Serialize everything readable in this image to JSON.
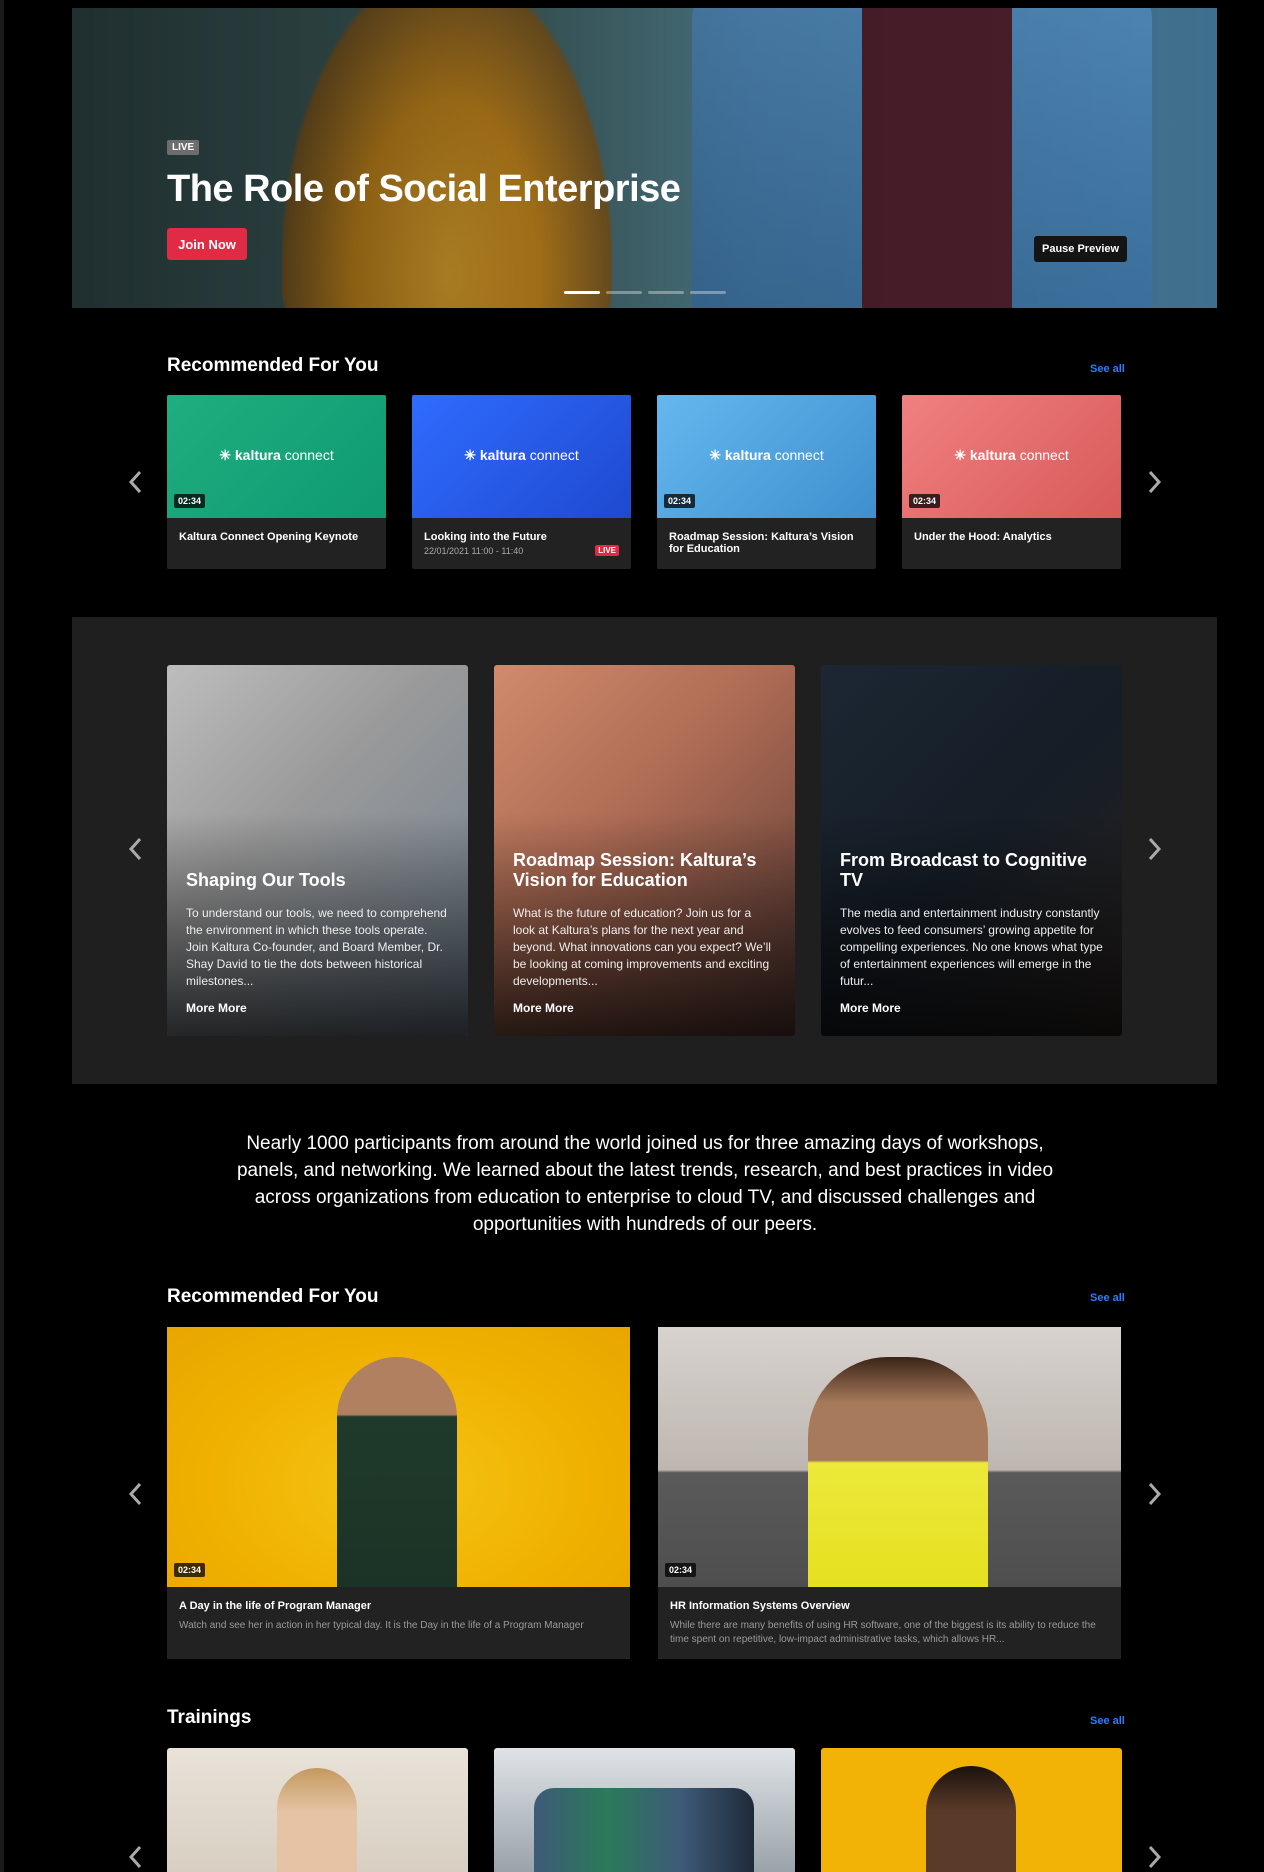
{
  "hero": {
    "live_tag": "LIVE",
    "title": "The Role of Social Enterprise",
    "join_label": "Join Now",
    "pause_label": "Pause Preview",
    "slide_count": 4,
    "active_slide": 1
  },
  "recommended1": {
    "title": "Recommended For You",
    "see_all": "See all",
    "cards": [
      {
        "logo": "kaltura",
        "logo2": "connect",
        "duration": "02:34",
        "title": "Kaltura Connect Opening Keynote",
        "date": "",
        "badge": ""
      },
      {
        "logo": "kaltura",
        "logo2": "connect",
        "duration": "",
        "title": "Looking into the Future",
        "date": "22/01/2021 11:00 - 11:40",
        "badge": "LIVE"
      },
      {
        "logo": "kaltura",
        "logo2": "connect",
        "duration": "02:34",
        "title": "Roadmap Session: Kaltura’s Vision for Education",
        "date": "",
        "badge": ""
      },
      {
        "logo": "kaltura",
        "logo2": "connect",
        "duration": "02:34",
        "title": "Under the Hood: Analytics",
        "date": "",
        "badge": ""
      }
    ]
  },
  "featured": {
    "cards": [
      {
        "title": "Shaping Our Tools",
        "desc": "To understand our tools, we need to comprehend the environment in which these tools operate. Join Kaltura Co-founder, and Board Member, Dr. Shay David to tie the dots between historical milestones...",
        "more": "More More"
      },
      {
        "title": "Roadmap Session: Kaltura’s Vision for Education",
        "desc": "What is the future of education? Join us for a look at Kaltura’s plans for the next year and beyond. What innovations can you expect? We’ll be looking at coming improvements and exciting developments...",
        "more": "More More"
      },
      {
        "title": "From Broadcast to Cognitive TV",
        "desc": "The media and entertainment industry constantly evolves to feed consumers’ growing appetite for compelling experiences. No one knows what type of entertainment experiences will emerge in the futur...",
        "more": "More More"
      }
    ]
  },
  "blurb": "Nearly 1000 participants from around the world joined us for three amazing days of workshops, panels, and networking. We learned about the latest trends, research, and best practices in video across organizations from education to enterprise to cloud TV, and discussed challenges and opportunities with hundreds of our peers.",
  "recommended2": {
    "title": "Recommended For You",
    "see_all": "See all",
    "cards": [
      {
        "duration": "02:34",
        "title": "A Day in the life of Program Manager",
        "desc": "Watch and see her in action in her typical day. It is the Day in the life of a Program Manager"
      },
      {
        "duration": "02:34",
        "title": "HR Information Systems Overview",
        "desc": "While there are many benefits of using HR software, one of the biggest is its ability to reduce the time spent on repetitive, low-impact administrative tasks, which allows HR..."
      }
    ]
  },
  "trainings": {
    "title": "Trainings",
    "see_all": "See all"
  },
  "colors": {
    "accent_red": "#e12a43",
    "link_blue": "#2f7bff",
    "card_bg": "#222222",
    "band_bg": "#1f1f1f"
  }
}
